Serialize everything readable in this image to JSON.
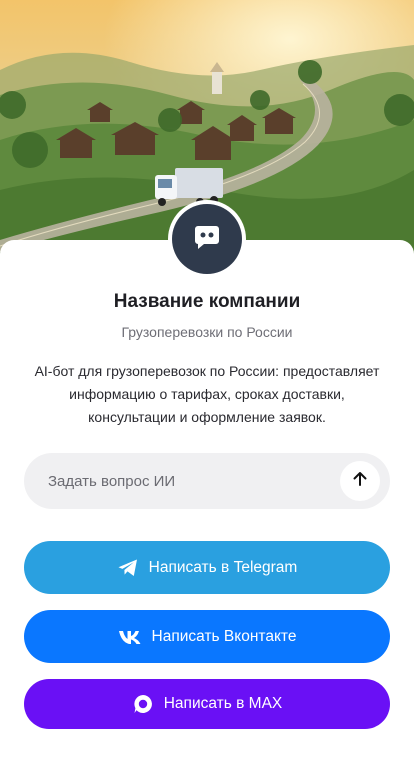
{
  "hero": {
    "image": "landscape-truck-village"
  },
  "avatar": {
    "icon": "chat-bot-icon"
  },
  "company": {
    "name": "Название компании",
    "subtitle": "Грузоперевозки по России",
    "description": "AI-бот для грузоперевозок по России: предоставляет информацию о тарифах, сроках доставки, консультации и оформление заявок."
  },
  "ask": {
    "placeholder": "Задать вопрос ИИ",
    "value": "",
    "send_icon": "arrow-up-icon"
  },
  "buttons": {
    "telegram": {
      "label": "Написать в Telegram",
      "color": "#2aa0e0",
      "icon": "telegram-icon"
    },
    "vk": {
      "label": "Написать Вконтакте",
      "color": "#0a77ff",
      "icon": "vk-icon"
    },
    "max": {
      "label": "Написать в MAX",
      "color": "#6a10f5",
      "icon": "max-icon"
    }
  }
}
